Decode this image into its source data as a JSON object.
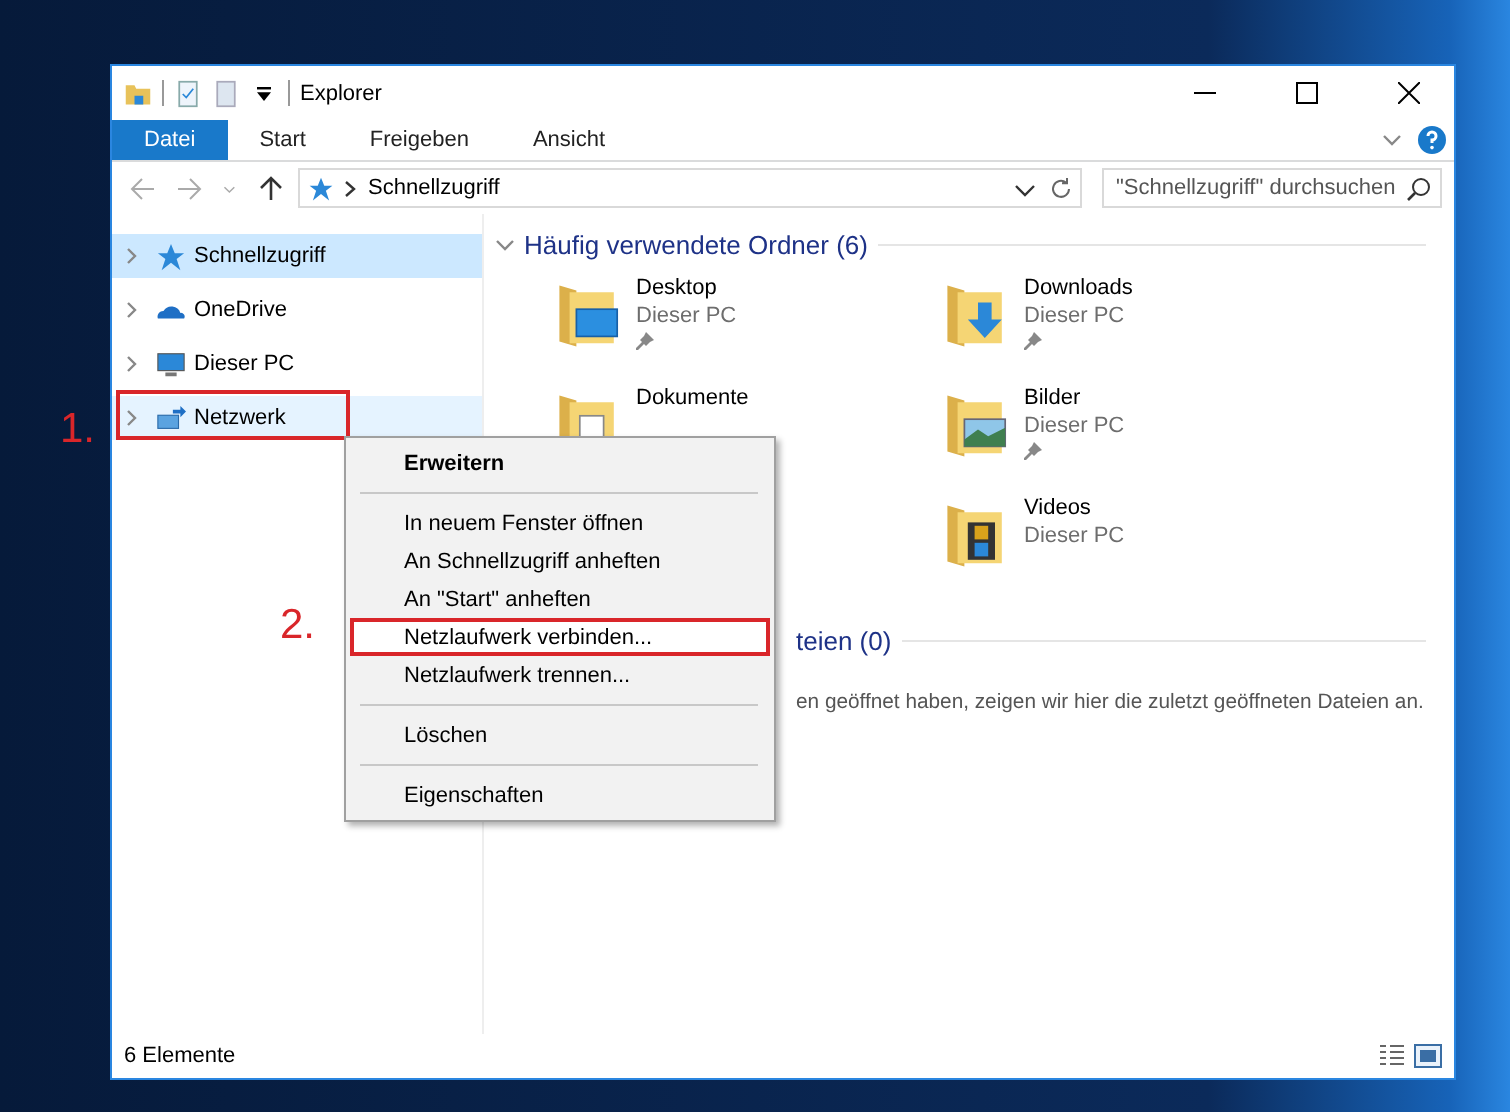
{
  "window": {
    "title": "Explorer"
  },
  "ribbon_tabs": [
    {
      "label": "Datei",
      "selected": true
    },
    {
      "label": "Start",
      "selected": false
    },
    {
      "label": "Freigeben",
      "selected": false
    },
    {
      "label": "Ansicht",
      "selected": false
    }
  ],
  "address_bar": {
    "path": "Schnellzugriff"
  },
  "search": {
    "placeholder": "\"Schnellzugriff\" durchsuchen"
  },
  "sidebar": {
    "items": [
      {
        "label": "Schnellzugriff",
        "kind": "quick",
        "selected": true,
        "hovered": false,
        "highlighted": false
      },
      {
        "label": "OneDrive",
        "kind": "cloud",
        "selected": false,
        "hovered": false,
        "highlighted": false
      },
      {
        "label": "Dieser PC",
        "kind": "pc",
        "selected": false,
        "hovered": false,
        "highlighted": false
      },
      {
        "label": "Netzwerk",
        "kind": "network",
        "selected": false,
        "hovered": true,
        "highlighted": true
      }
    ]
  },
  "frequent_folders": {
    "heading": "Häufig verwendete Ordner (6)",
    "items": [
      {
        "name": "Desktop",
        "location": "Dieser PC",
        "kind": "desktop",
        "pinned": true
      },
      {
        "name": "Downloads",
        "location": "Dieser PC",
        "kind": "downloads",
        "pinned": true
      },
      {
        "name": "Dokumente",
        "kind": "documents",
        "pinned": false
      },
      {
        "name": "Bilder",
        "location": "Dieser PC",
        "kind": "pictures",
        "pinned": true
      },
      {
        "name": "Videos",
        "location": "Dieser PC",
        "kind": "videos",
        "pinned": false
      }
    ]
  },
  "recent_files": {
    "heading": "teien (0)",
    "message": "en geöffnet haben, zeigen wir hier die zuletzt geöffneten Dateien an."
  },
  "context_menu": {
    "items": [
      {
        "label": "Erweitern",
        "kind": "default",
        "highlighted": false
      },
      {
        "kind": "separator"
      },
      {
        "label": "In neuem Fenster öffnen",
        "kind": "item",
        "highlighted": false
      },
      {
        "label": "An Schnellzugriff anheften",
        "kind": "item",
        "highlighted": false
      },
      {
        "label": "An \"Start\" anheften",
        "kind": "item",
        "highlighted": false
      },
      {
        "label": "Netzlaufwerk verbinden...",
        "kind": "item",
        "highlighted": true
      },
      {
        "label": "Netzlaufwerk trennen...",
        "kind": "item",
        "highlighted": false
      },
      {
        "kind": "separator"
      },
      {
        "label": "Löschen",
        "kind": "item",
        "highlighted": false
      },
      {
        "kind": "separator"
      },
      {
        "label": "Eigenschaften",
        "kind": "item",
        "highlighted": false
      }
    ]
  },
  "annotations": [
    {
      "label": "1."
    },
    {
      "label": "2."
    }
  ],
  "status_bar": {
    "count": "6 Elemente"
  }
}
